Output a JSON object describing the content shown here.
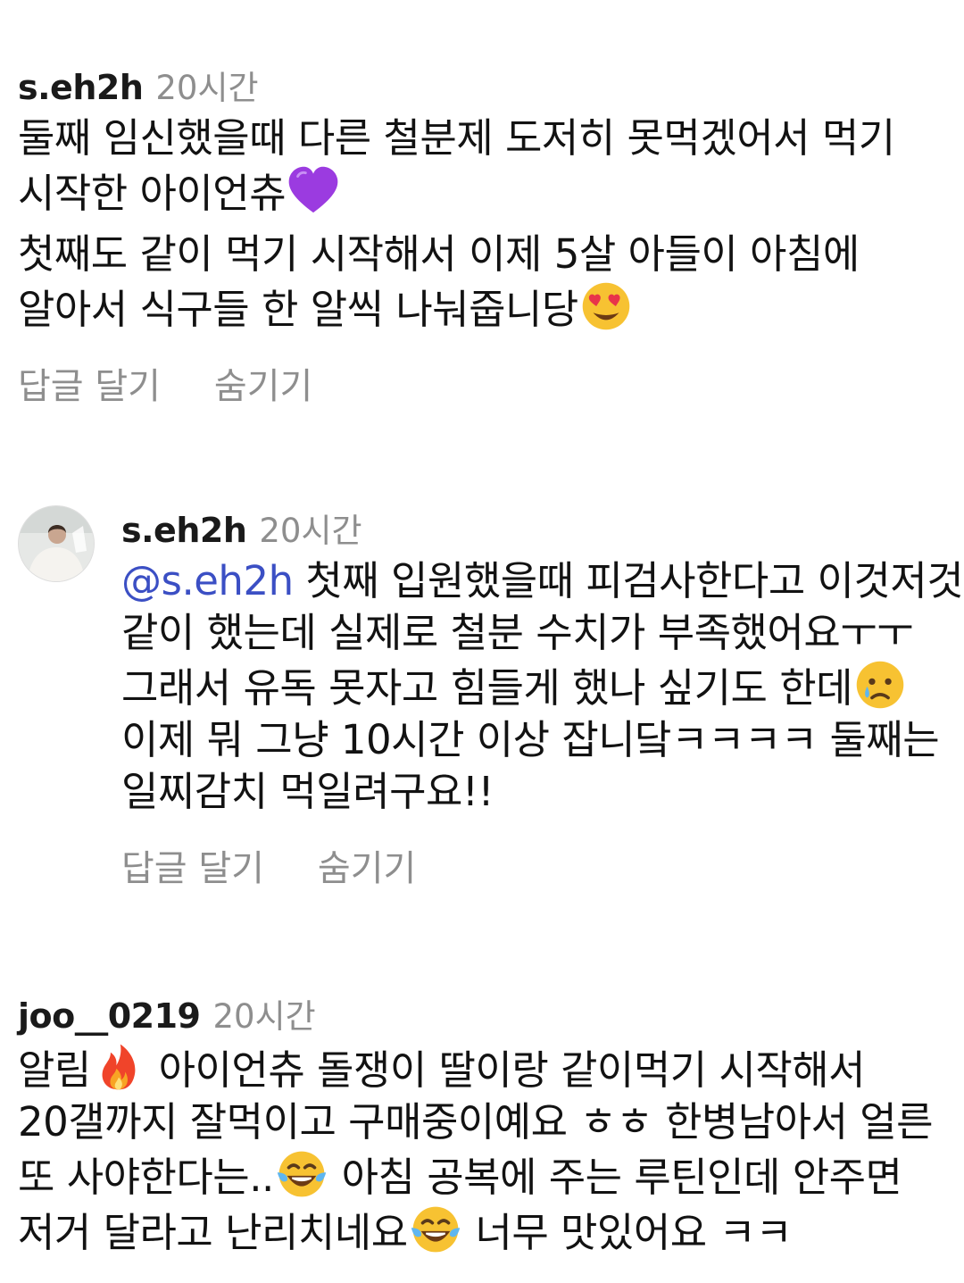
{
  "comments": [
    {
      "username": "s.eh2h",
      "time": "20시간",
      "para1_a": "둘째 임신했을때 다른 철분제 도저히 못먹겠어서 먹기 시작한 아이언츄",
      "para2_a": "첫째도 같이 먹기 시작해서 이제 5살 아들이 아침에 알아서 식구들 한 알씩 나눠줍니당",
      "reply_label": "답글 달기",
      "hide_label": "숨기기",
      "emojis": [
        "purple-heart-icon",
        "heart-eyes-face-icon"
      ]
    },
    {
      "username": "s.eh2h",
      "time": "20시간",
      "mention": "@s.eh2h",
      "text_a": " 첫째 입원했을때 피검사한다고 이것저것 같이 했는데 실제로 철분 수치가 부족했어요ㅜㅜ 그래서 유독 못자고 힘들게 했나 싶기도 한데",
      "text_b": " 이제 뭐 그냥 10시간 이상 잡니닼ㅋㅋㅋㅋ 둘째는 일찌감치 먹일려구요!!",
      "reply_label": "답글 달기",
      "hide_label": "숨기기",
      "emojis": [
        "crying-face-icon"
      ]
    },
    {
      "username": "joo__0219",
      "time": "20시간",
      "text_a": "알림",
      "text_b": " 아이언츄 돌쟁이 딸이랑 같이먹기 시작해서 20갤까지 잘먹이고 구매중이예요 ㅎㅎ 한병남아서 얼른 또 사야한다는..",
      "text_c": " 아침 공복에 주는 루틴인데 안주면 저거 달라고 난리치네요",
      "text_d": " 너무 맛있어요 ㅋㅋ",
      "emojis": [
        "fire-icon",
        "laughing-tears-face-icon",
        "laughing-tears-face-icon"
      ]
    }
  ],
  "colors": {
    "text": "#121212",
    "muted": "#8e8e8e",
    "mention": "#3b4fc4",
    "background": "#ffffff"
  }
}
